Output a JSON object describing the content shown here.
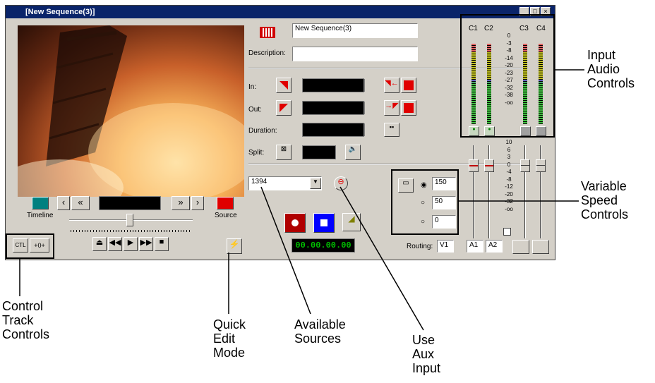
{
  "window": {
    "title": "[New Sequence(3)]"
  },
  "sequence": {
    "name": "New Sequence(3)",
    "description_label": "Description:",
    "description_value": ""
  },
  "labels": {
    "in": "In:",
    "out": "Out:",
    "duration": "Duration:",
    "split": "Split:",
    "timeline": "Timeline",
    "source": "Source",
    "routing": "Routing:"
  },
  "source_select": {
    "value": "1394"
  },
  "timecode": "00.00.00.00",
  "ctl": {
    "ctl_label": "CTL",
    "zero_label": "+0+"
  },
  "speed": {
    "values": [
      "150",
      "50",
      "0"
    ]
  },
  "routing": {
    "video": "V1",
    "audio": [
      "A1",
      "A2"
    ]
  },
  "audio": {
    "channels": [
      "C1",
      "C2",
      "C3",
      "C4"
    ],
    "meter_scale": [
      "0",
      "-3",
      "-8",
      "-14",
      "-20",
      "-23",
      "-27",
      "-32",
      "-38",
      "-oo"
    ],
    "fader_scale": [
      "10",
      "6",
      "3",
      "0",
      "-4",
      "-8",
      "-12",
      "-20",
      "-32",
      "-oo"
    ]
  },
  "callouts": {
    "input_audio": [
      "Input",
      "Audio",
      "Controls"
    ],
    "variable_speed": [
      "Variable",
      "Speed",
      "Controls"
    ],
    "control_track": [
      "Control",
      "Track",
      "Controls"
    ],
    "quick_edit": [
      "Quick",
      "Edit",
      "Mode"
    ],
    "available_sources": [
      "Available",
      "Sources"
    ],
    "use_aux": [
      "Use",
      "Aux",
      "Input"
    ]
  },
  "colors": {
    "titlebar": "#0a246a",
    "window": "#d4d0c8",
    "record": "#c00000",
    "play": "#0000ff",
    "timecode": "#00c000"
  }
}
